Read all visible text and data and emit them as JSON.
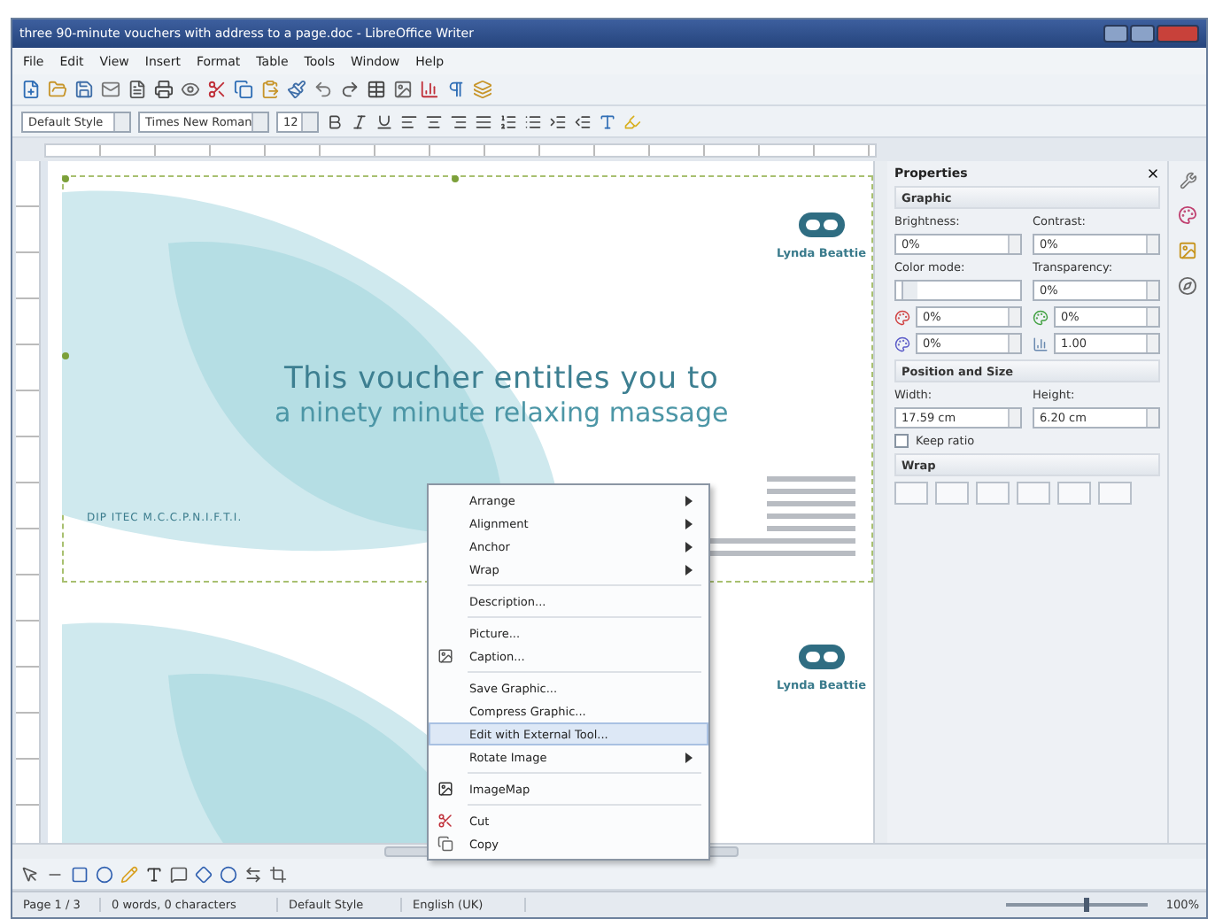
{
  "window": {
    "title": "three 90-minute vouchers with address to a page.doc - LibreOffice Writer"
  },
  "menu": [
    "File",
    "Edit",
    "View",
    "Insert",
    "Format",
    "Table",
    "Tools",
    "Window",
    "Help"
  ],
  "formatting": {
    "style": "Default Style",
    "font": "Times New Roman",
    "size": "12"
  },
  "document": {
    "vouchers": [
      {
        "name": "Lynda Beattie",
        "headline": "This voucher entitles you to",
        "subline": "a ninety minute relaxing massage",
        "credentials": "DIP ITEC M.C.C.P.N.I.F.T.I.",
        "selected": true
      },
      {
        "name": "Lynda Beattie",
        "selected": false
      }
    ]
  },
  "context_menu": [
    {
      "kind": "item",
      "label": "Arrange",
      "submenu": true,
      "selected": false
    },
    {
      "kind": "item",
      "label": "Alignment",
      "submenu": true,
      "selected": false
    },
    {
      "kind": "item",
      "label": "Anchor",
      "submenu": true,
      "selected": false
    },
    {
      "kind": "item",
      "label": "Wrap",
      "submenu": true,
      "selected": false
    },
    {
      "kind": "separator"
    },
    {
      "kind": "item",
      "label": "Description...",
      "submenu": false,
      "selected": false
    },
    {
      "kind": "separator"
    },
    {
      "kind": "item",
      "label": "Picture...",
      "submenu": false,
      "selected": false
    },
    {
      "kind": "item",
      "label": "Caption...",
      "submenu": false,
      "selected": false
    },
    {
      "kind": "separator"
    },
    {
      "kind": "item",
      "label": "Save Graphic...",
      "submenu": false,
      "selected": false
    },
    {
      "kind": "item",
      "label": "Compress Graphic...",
      "submenu": false,
      "selected": false
    },
    {
      "kind": "item",
      "label": "Edit with External Tool...",
      "submenu": false,
      "selected": true
    },
    {
      "kind": "item",
      "label": "Rotate Image",
      "submenu": true,
      "selected": false
    },
    {
      "kind": "separator"
    },
    {
      "kind": "item",
      "label": "ImageMap",
      "submenu": false,
      "selected": false
    },
    {
      "kind": "separator"
    },
    {
      "kind": "item",
      "label": "Cut",
      "submenu": false,
      "selected": false
    },
    {
      "kind": "item",
      "label": "Copy",
      "submenu": false,
      "selected": false
    }
  ],
  "sidebar": {
    "title": "Properties",
    "graphic": {
      "title": "Graphic",
      "brightness": {
        "label": "Brightness:",
        "value": "0%"
      },
      "contrast": {
        "label": "Contrast:",
        "value": "0%"
      },
      "color_mode": {
        "label": "Color mode:"
      },
      "transparency": {
        "label": "Transparency:",
        "value": "0%"
      },
      "red": "0%",
      "green": "0%",
      "blue": "0%",
      "gamma": "1.00"
    },
    "position": {
      "title": "Position and Size",
      "width": {
        "label": "Width:",
        "value": "17.59 cm"
      },
      "height": {
        "label": "Height:",
        "value": "6.20 cm"
      },
      "keep_ratio": {
        "label": "Keep ratio",
        "checked": false
      }
    },
    "wrap": {
      "title": "Wrap"
    }
  },
  "status_bar": {
    "items": [
      "Page 1 / 3",
      "0 words, 0 characters",
      "Default Style",
      "English (UK)"
    ],
    "zoom": {
      "level": 0.55,
      "reading": "100%"
    }
  }
}
